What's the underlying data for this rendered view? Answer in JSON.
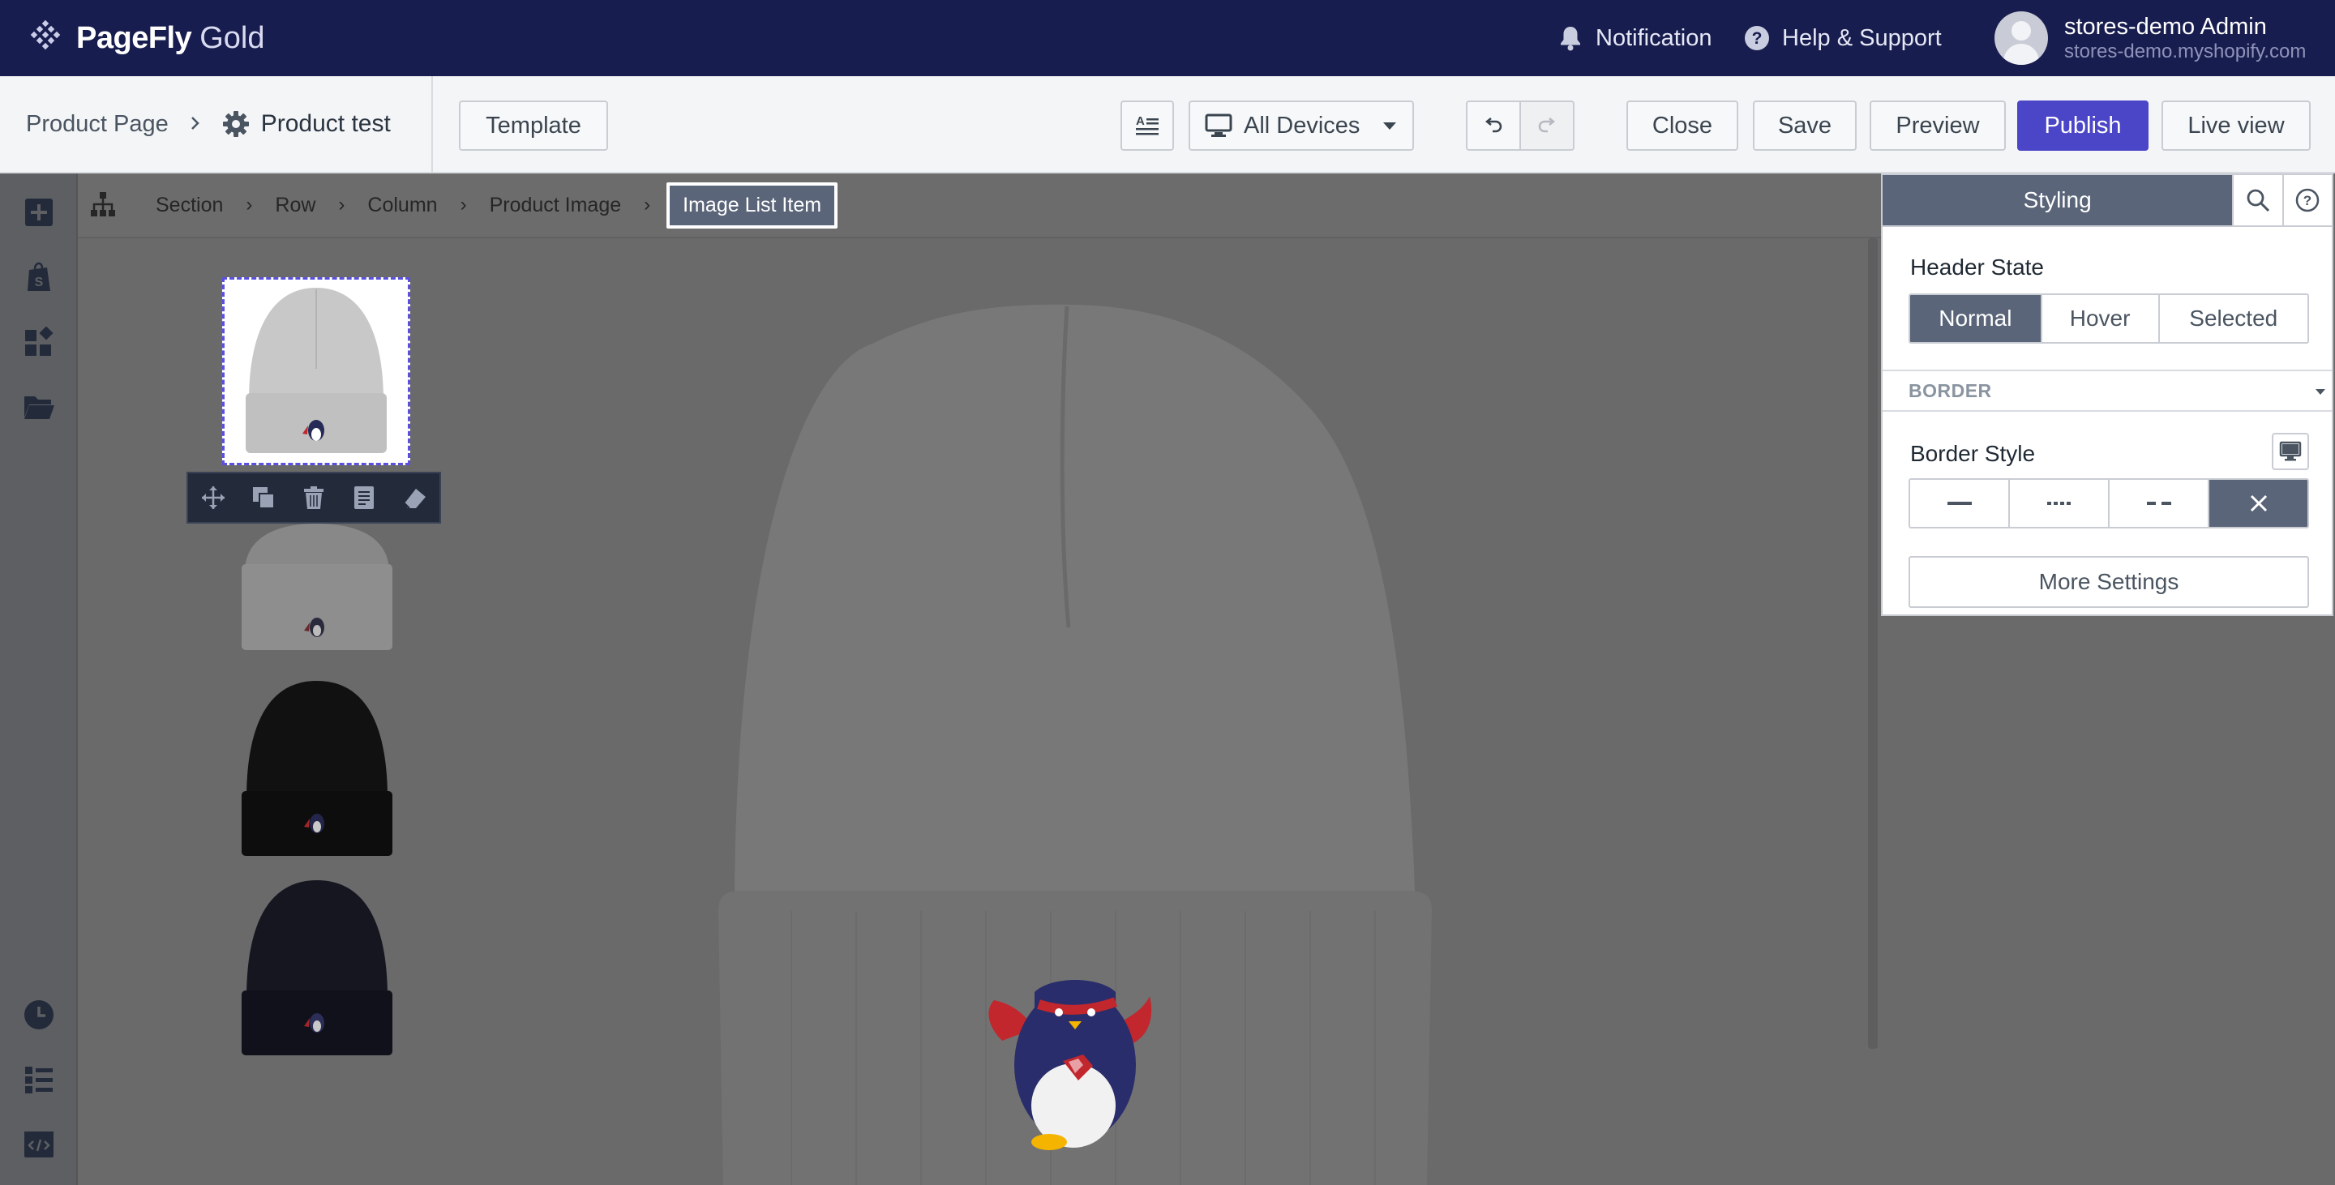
{
  "app": {
    "brand": "PageFly",
    "brand_tier": "Gold"
  },
  "topnav": {
    "notification_label": "Notification",
    "help_label": "Help & Support",
    "user_name": "stores-demo Admin",
    "user_shop": "stores-demo.myshopify.com"
  },
  "toolbar": {
    "crumb_root": "Product Page",
    "page_name": "Product test",
    "template_label": "Template",
    "devices_label": "All Devices",
    "close_label": "Close",
    "save_label": "Save",
    "preview_label": "Preview",
    "publish_label": "Publish",
    "live_view_label": "Live view"
  },
  "breadcrumb": {
    "items": [
      "Section",
      "Row",
      "Column",
      "Product Image"
    ],
    "active": "Image List Item"
  },
  "product": {
    "thumbnail_colors": [
      "#ffffff",
      "#c2c2c2",
      "#111111",
      "#151620"
    ],
    "main_color": "#777777"
  },
  "panel": {
    "tab_label": "Styling",
    "header_state_label": "Header State",
    "states": [
      "Normal",
      "Hover",
      "Selected"
    ],
    "active_state": "Normal",
    "section_title": "BORDER",
    "border_style_label": "Border Style",
    "border_styles": [
      "solid",
      "dotted",
      "dashed",
      "none"
    ],
    "active_border_style": "none",
    "more_settings_label": "More Settings"
  },
  "colors": {
    "nav_bg": "#181d4f",
    "accent": "#4b45c7",
    "panel_active": "#5a6579"
  }
}
